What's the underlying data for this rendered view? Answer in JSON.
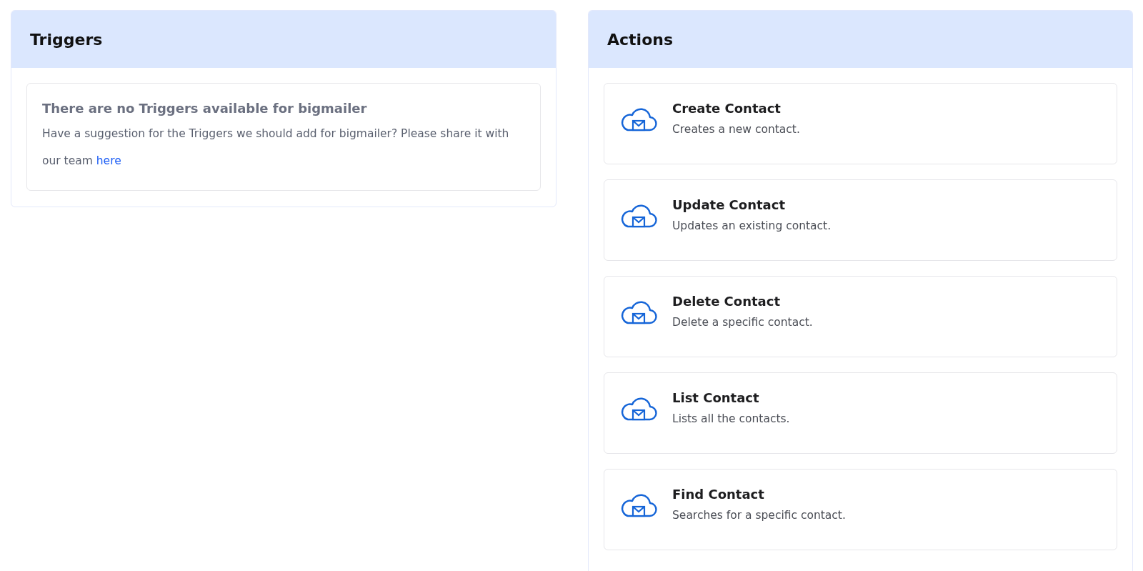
{
  "triggers": {
    "title": "Triggers",
    "empty_title": "There are no Triggers available for bigmailer",
    "message": "Have a suggestion for the Triggers we should add for bigmailer? Please share it with our team",
    "link": "here"
  },
  "actions": {
    "title": "Actions",
    "items": [
      {
        "name": "Create Contact",
        "description": "Creates a new contact."
      },
      {
        "name": "Update Contact",
        "description": "Updates an existing contact."
      },
      {
        "name": "Delete Contact",
        "description": "Delete a specific contact."
      },
      {
        "name": "List Contact",
        "description": "Lists all the contacts."
      },
      {
        "name": "Find Contact",
        "description": "Searches for a specific contact."
      }
    ]
  }
}
